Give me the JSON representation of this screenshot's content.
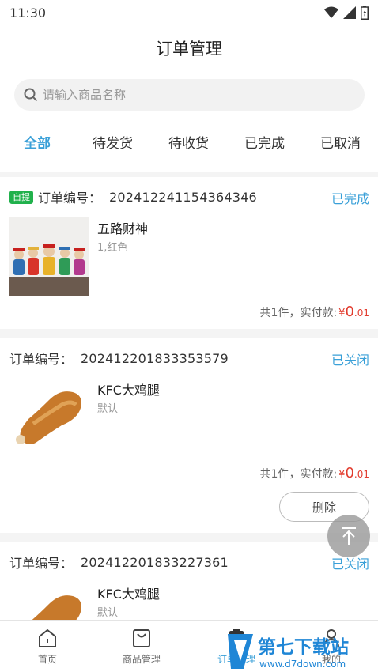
{
  "status_bar": {
    "time": "11:30",
    "icons": [
      "wifi-icon",
      "signal-icon",
      "battery-icon"
    ]
  },
  "header": {
    "title": "订单管理",
    "search": {
      "placeholder": "请输入商品名称",
      "value": ""
    }
  },
  "tabs": [
    {
      "label": "全部",
      "active": true
    },
    {
      "label": "待发货",
      "active": false
    },
    {
      "label": "待收货",
      "active": false
    },
    {
      "label": "已完成",
      "active": false
    },
    {
      "label": "已取消",
      "active": false
    }
  ],
  "orders": [
    {
      "badge": "自提",
      "order_label": "订单编号：",
      "order_no": "202412241154364346",
      "status": "已完成",
      "product_name": "五路财神",
      "product_spec": "1,红色",
      "summary_text": "共1件，实付款:",
      "currency": "¥",
      "price_int": "0",
      "price_dec": ".01"
    },
    {
      "order_label": "订单编号：",
      "order_no": "202412201833353579",
      "status": "已关闭",
      "product_name": "KFC大鸡腿",
      "product_spec": "默认",
      "summary_text": "共1件，实付款:",
      "currency": "¥",
      "price_int": "0",
      "price_dec": ".01",
      "action_label": "删除"
    },
    {
      "order_label": "订单编号：",
      "order_no": "202412201833227361",
      "status": "已关闭",
      "product_name": "KFC大鸡腿",
      "product_spec": "默认"
    }
  ],
  "tabbar": [
    {
      "label": "首页",
      "icon": "home-icon",
      "active": false
    },
    {
      "label": "商品管理",
      "icon": "bag-icon",
      "active": false
    },
    {
      "label": "订单管理",
      "icon": "clipboard-icon",
      "active": true
    },
    {
      "label": "我的",
      "icon": "person-icon",
      "active": false
    }
  ],
  "watermark": {
    "brand": "第七下载站",
    "url": "www.d7down.com"
  },
  "colors": {
    "accent": "#3aa0d8",
    "price": "#e23c2e",
    "badge": "#21b14c"
  }
}
